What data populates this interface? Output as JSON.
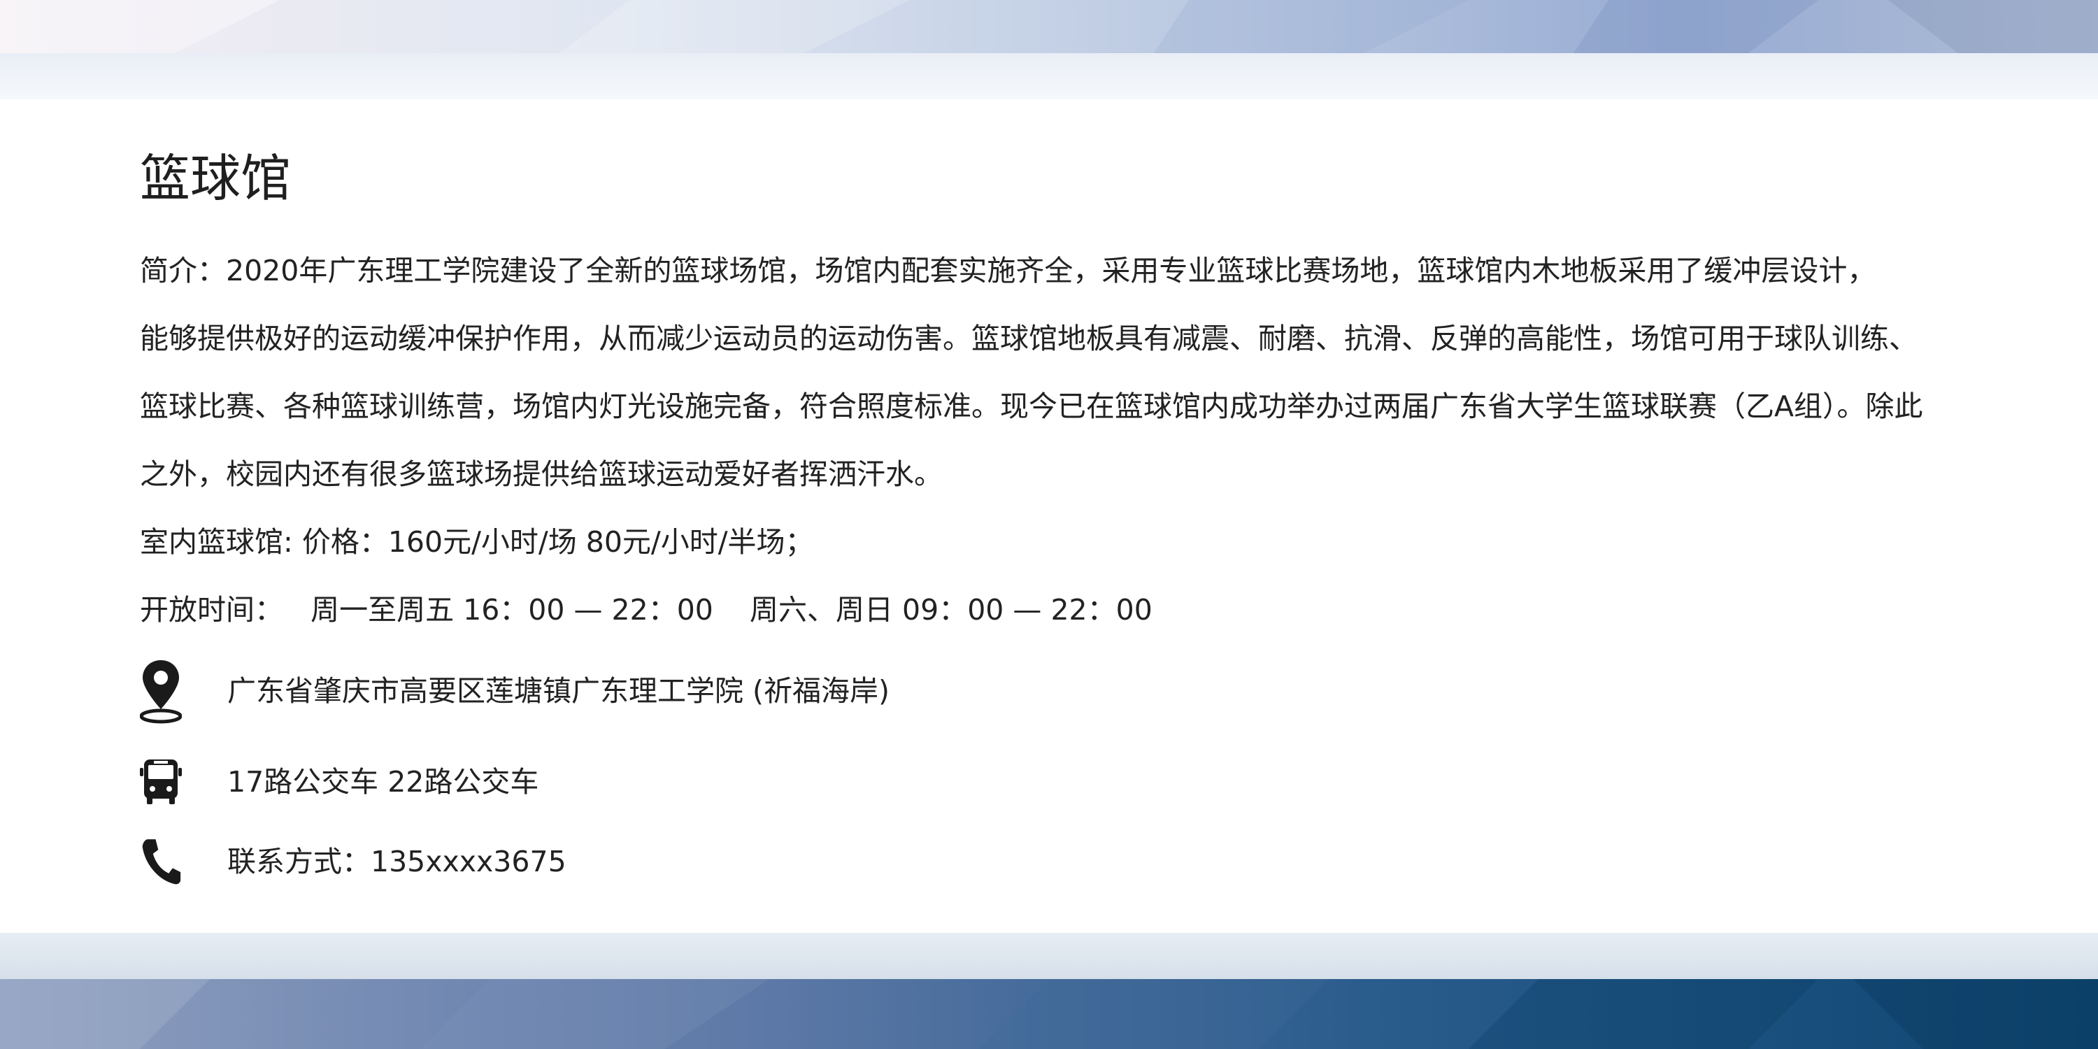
{
  "title": "篮球馆",
  "description_lines": [
    "简介：2020年广东理工学院建设了全新的篮球场馆，场馆内配套实施齐全，采用专业篮球比赛场地，篮球馆内木地板采用了缓冲层设计，",
    "能够提供极好的运动缓冲保护作用，从而减少运动员的运动伤害。篮球馆地板具有减震、耐磨、抗滑、反弹的高能性，场馆可用于球队训练、",
    "篮球比赛、各种篮球训练营，场馆内灯光设施完备，符合照度标准。现今已在篮球馆内成功举办过两届广东省大学生篮球联赛（乙A组）。除此",
    "之外，校园内还有很多篮球场提供给篮球运动爱好者挥洒汗水。"
  ],
  "price": "室内篮球馆: 价格：160元/小时/场 80元/小时/半场；",
  "hours": "开放时间：   周一至周五 16：00 — 22：00    周六、周日 09：00 — 22：00",
  "contact": {
    "address": "广东省肇庆市高要区莲塘镇广东理工学院 (祈福海岸)",
    "bus": "17路公交车 22路公交车",
    "phone": "联系方式：135xxxx3675"
  },
  "icons": {
    "address": "location-pin-icon",
    "bus": "bus-icon",
    "phone": "phone-icon"
  },
  "colors": {
    "text": "#222222",
    "icon": "#1a1a1a",
    "band_top_light": "#e9eef6",
    "band_top_blue": "#8ea4cc",
    "band_bottom_dark": "#134a78"
  }
}
